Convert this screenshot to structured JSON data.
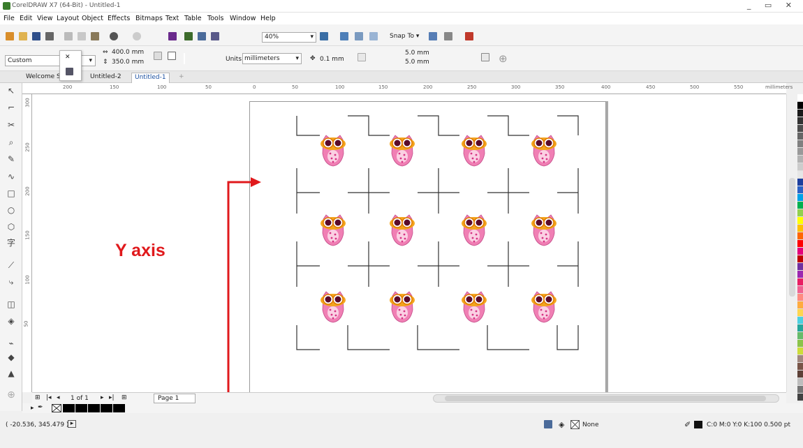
{
  "window": {
    "title": "CorelDRAW X7 (64-Bit) - Untitled-1",
    "controls": "_ ▭ ✕"
  },
  "menu": [
    "File",
    "Edit",
    "View",
    "Layout",
    "Object",
    "Effects",
    "Bitmaps",
    "Text",
    "Table",
    "Tools",
    "Window",
    "Help"
  ],
  "toolbar": {
    "zoom": "40%",
    "snap_to": "Snap To"
  },
  "propbar": {
    "preset": "Custom",
    "width": "400.0 mm",
    "height": "350.0 mm",
    "units_label": "Units:",
    "units_value": "millimeters",
    "nudge": "0.1 mm",
    "dup_x": "5.0 mm",
    "dup_y": "5.0 mm"
  },
  "tabs": [
    "Welcome Sc",
    "Untitled-2",
    "Untitled-1",
    "+"
  ],
  "ruler": {
    "h_ticks": [
      "200",
      "150",
      "100",
      "50",
      "0",
      "50",
      "100",
      "150",
      "200",
      "250",
      "300",
      "350",
      "400",
      "450",
      "500",
      "550"
    ],
    "units": "millimeters",
    "v_ticks": [
      "300",
      "250",
      "200",
      "150",
      "100",
      "50"
    ]
  },
  "nav": {
    "counter": "1 of 1",
    "page_tab": "Page 1"
  },
  "status": {
    "coords": "( -20.536, 345.479 )",
    "fill": "None",
    "outline": "C:0 M:0 Y:0 K:100  0.500 pt"
  },
  "annotation": {
    "label": "Y axis",
    "color": "#e0191c"
  },
  "palette_colors": [
    "#ffffff",
    "#000000",
    "#1a1a1a",
    "#333333",
    "#4d4d4d",
    "#666666",
    "#808080",
    "#999999",
    "#b3b3b3",
    "#cccccc",
    "#e6e6e6",
    "#1d3f9e",
    "#2c62c5",
    "#00a2e8",
    "#00b050",
    "#92d050",
    "#ffff00",
    "#ffc000",
    "#ff6600",
    "#ff0000",
    "#e4007c",
    "#c00000",
    "#7030a0",
    "#9c27b0",
    "#e91e63",
    "#f06292",
    "#ff8a80",
    "#ffab40",
    "#ffd54f",
    "#4dd0e1",
    "#26a69a",
    "#66bb6a",
    "#8bc34a",
    "#cddc39",
    "#a1887f",
    "#795548",
    "#5d4037",
    "#bdbdbd",
    "#757575",
    "#424242"
  ],
  "swatch_colors": [
    "#000000",
    "#000000",
    "#000000",
    "#000000",
    "#000000"
  ]
}
